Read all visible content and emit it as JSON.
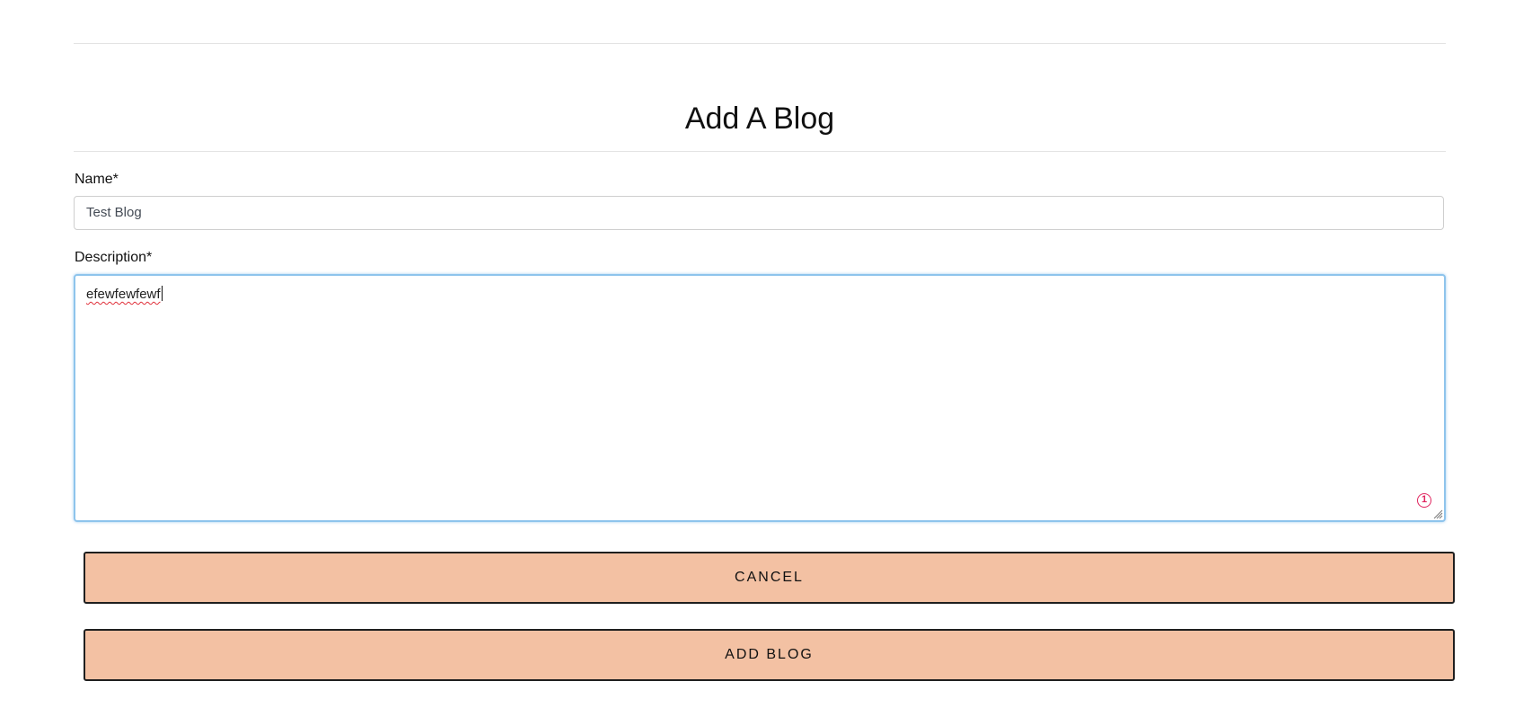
{
  "form": {
    "title": "Add A Blog",
    "name_label": "Name*",
    "name_value": "Test Blog",
    "description_label": "Description*",
    "description_value": "efewfewfewf",
    "grammar_badge_count": "1"
  },
  "actions": {
    "cancel_label": "CANCEL",
    "add_label": "ADD BLOG"
  },
  "colors": {
    "button_fill": "#f3c1a3",
    "focus_border": "#8ec4ec",
    "spellcheck_underline": "#e0303a",
    "badge": "#e0245e"
  },
  "icons": {
    "grammar_badge": "grammar-check-icon",
    "resize": "resize-handle-icon"
  }
}
